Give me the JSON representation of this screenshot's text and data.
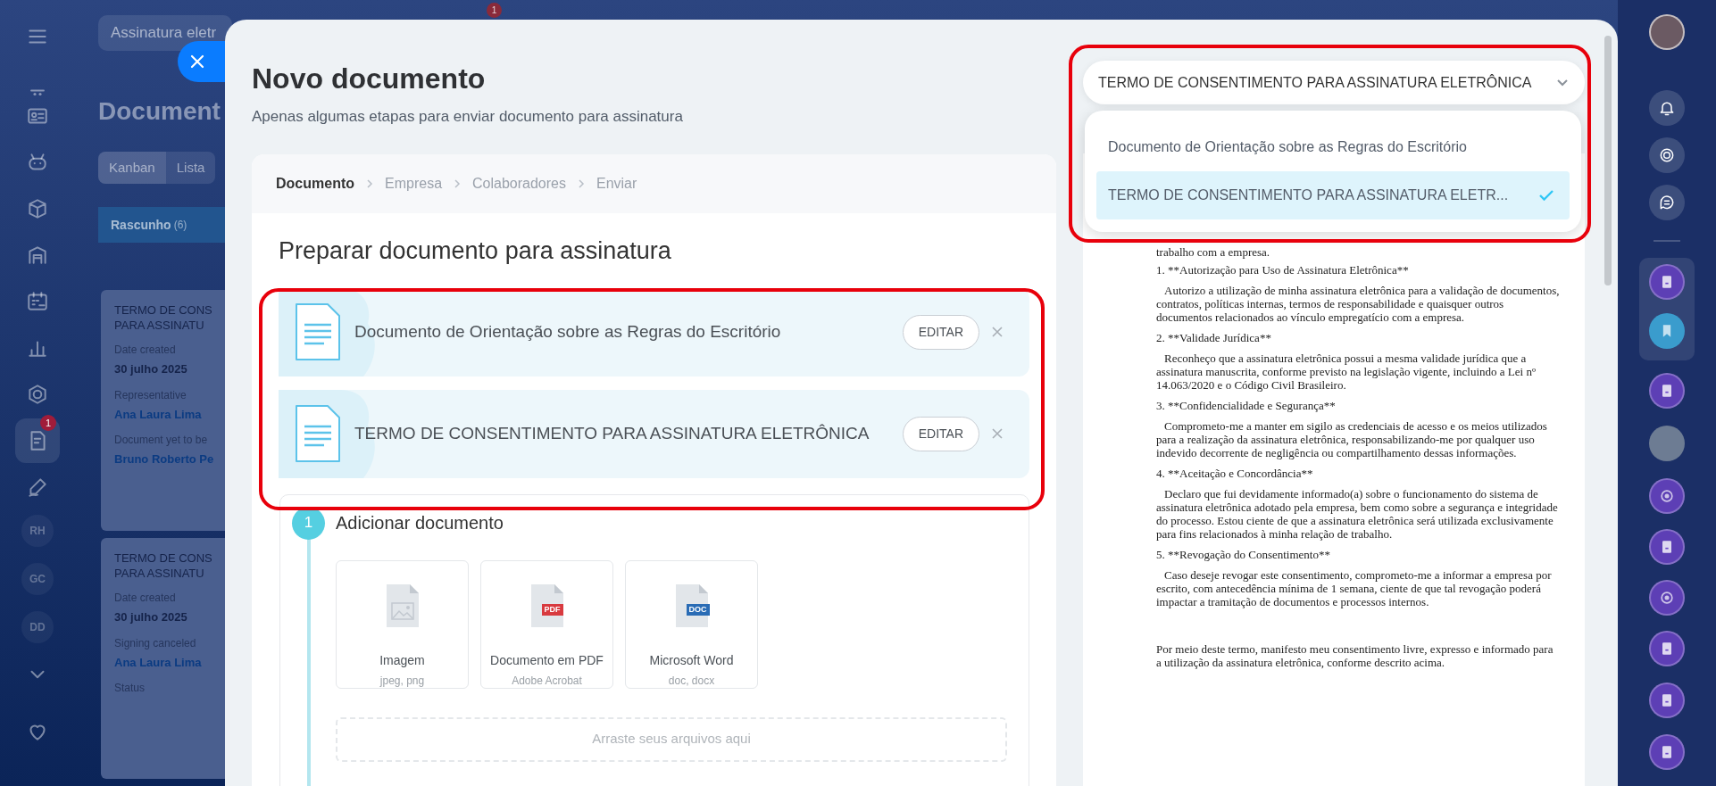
{
  "background": {
    "search": "Assinatura eletr",
    "badge": "1",
    "title": "Document",
    "view_tabs": [
      {
        "label": "Kanban",
        "selected": true
      },
      {
        "label": "Lista",
        "selected": false
      }
    ],
    "column": {
      "title": "Rascunho",
      "count": "(6)"
    },
    "cards": [
      {
        "title": "TERMO DE CONS\nPARA ASSINATU",
        "fields": [
          {
            "label": "Date created",
            "value": "30 julho 2025",
            "kind": "text"
          },
          {
            "label": "Representative",
            "value": "Ana Laura Lima",
            "kind": "person"
          },
          {
            "label": "Document yet to be",
            "value": "Bruno Roberto Pe",
            "kind": "person"
          }
        ]
      },
      {
        "title": "TERMO DE CONS\nPARA ASSINATU",
        "fields": [
          {
            "label": "Date created",
            "value": "30 julho 2025",
            "kind": "text"
          },
          {
            "label": "Signing canceled",
            "value": "Ana Laura Lima",
            "kind": "person"
          },
          {
            "label": "Status"
          }
        ]
      }
    ]
  },
  "sidebar": {
    "badge": "1",
    "initials": [
      "RH",
      "GC",
      "DD"
    ]
  },
  "modal": {
    "title": "Novo documento",
    "subtitle": "Apenas algumas etapas para enviar documento para assinatura",
    "steps": [
      {
        "label": "Documento",
        "selected": true
      },
      {
        "label": "Empresa",
        "selected": false
      },
      {
        "label": "Colaboradores",
        "selected": false
      },
      {
        "label": "Enviar",
        "selected": false
      }
    ],
    "heading": "Preparar documento para assinatura",
    "documents": [
      {
        "name": "Documento de Orientação sobre as Regras do Escritório",
        "button": "EDITAR"
      },
      {
        "name": "TERMO DE CONSENTIMENTO PARA ASSINATURA ELETRÔNICA",
        "button": "EDITAR"
      }
    ],
    "add_step": {
      "number": "1",
      "title": "Adicionar documento",
      "types": [
        {
          "kind": "image",
          "name": "Imagem",
          "formats": "jpeg, png"
        },
        {
          "kind": "pdf",
          "tag": "PDF",
          "name": "Documento em PDF",
          "formats": "Adobe Acrobat"
        },
        {
          "kind": "doc",
          "tag": "DOC",
          "name": "Microsoft Word",
          "formats": "doc, docx"
        }
      ],
      "dropzone": "Arraste seus arquivos aqui"
    },
    "selector": {
      "value": "TERMO DE CONSENTIMENTO PARA ASSINATURA ELETRÔNICA",
      "options": [
        {
          "label": "Documento de Orientação sobre as Regras do Escritório",
          "selected": false
        },
        {
          "label": "TERMO DE CONSENTIMENTO PARA ASSINATURA ELETR...",
          "selected": true
        }
      ]
    },
    "preview": [
      {
        "kind": "continuation",
        "text": "trabalho com a empresa."
      },
      {
        "kind": "item",
        "text": "1. **Autorização para Uso de Assinatura Eletrônica**"
      },
      {
        "kind": "body",
        "text": "Autorizo a utilização de minha assinatura eletrônica para a validação de documentos, contratos, políticas internas, termos de responsabilidade e quaisquer outros documentos relacionados ao vínculo empregatício com a empresa."
      },
      {
        "kind": "item",
        "text": "2. **Validade Jurídica**"
      },
      {
        "kind": "body",
        "text": "Reconheço que a assinatura eletrônica possui a mesma validade jurídica que a assinatura manuscrita, conforme previsto na legislação vigente, incluindo a Lei nº 14.063/2020 e o Código Civil Brasileiro."
      },
      {
        "kind": "item",
        "text": "3. **Confidencialidade e Segurança**"
      },
      {
        "kind": "body",
        "text": "Comprometo-me a manter em sigilo as credenciais de acesso e os meios utilizados para a realização da assinatura eletrônica, responsabilizando-me por qualquer uso indevido decorrente de negligência ou compartilhamento dessas informações."
      },
      {
        "kind": "item",
        "text": "4. **Aceitação e Concordância**"
      },
      {
        "kind": "body",
        "text": "Declaro que fui devidamente informado(a) sobre o funcionamento do sistema de assinatura eletrônica adotado pela empresa, bem como sobre a segurança e integridade do processo. Estou ciente de que a assinatura eletrônica será utilizada exclusivamente para fins relacionados à minha relação de trabalho."
      },
      {
        "kind": "item",
        "text": "5. **Revogação do Consentimento**"
      },
      {
        "kind": "body",
        "text": "Caso deseje revogar este consentimento, comprometo-me a informar a empresa por escrito, com antecedência mínima de 1 semana, ciente de que tal revogação poderá impactar a tramitação de documentos e processos internos."
      },
      {
        "kind": "closing",
        "text": "Por meio deste termo, manifesto meu consentimento livre, expresso e informado para a utilização da assinatura eletrônica, conforme descrito acima."
      }
    ]
  }
}
